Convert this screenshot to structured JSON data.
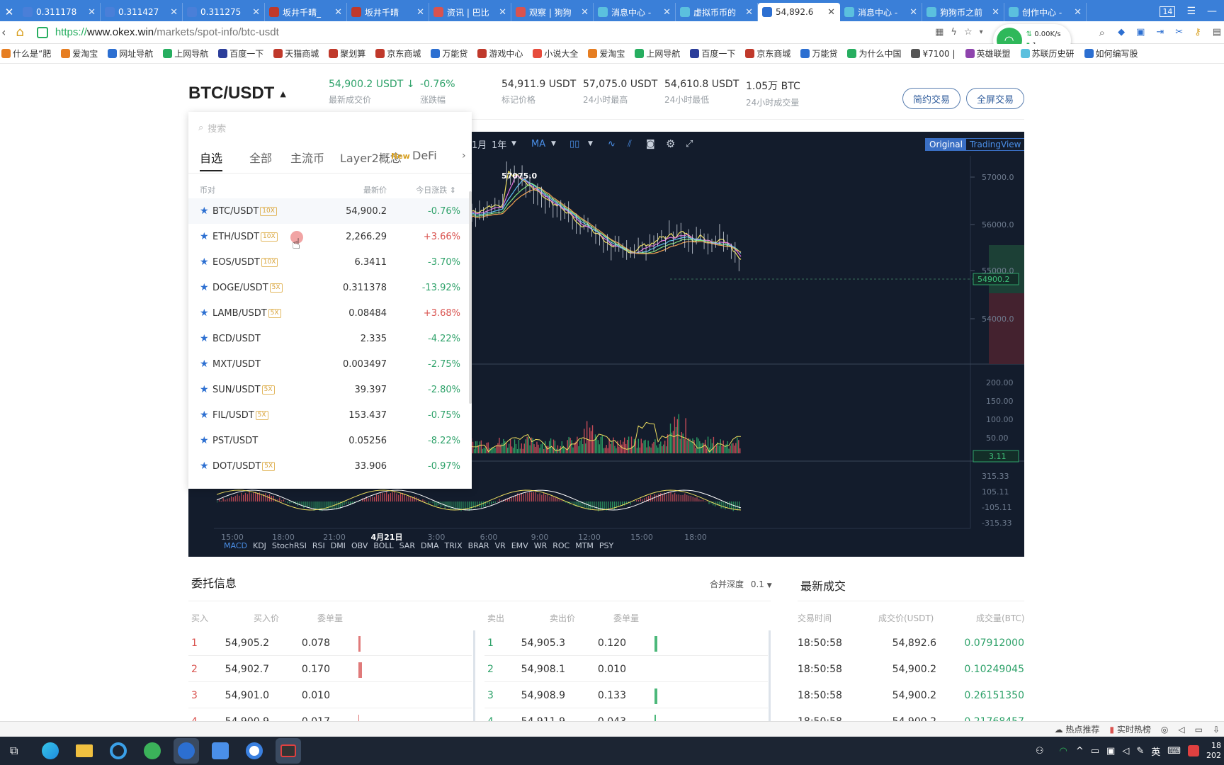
{
  "browser": {
    "tabs": [
      {
        "title": "0.311178",
        "fav": "#4a7fd8"
      },
      {
        "title": "0.311427",
        "fav": "#4a7fd8"
      },
      {
        "title": "0.311275",
        "fav": "#4a7fd8"
      },
      {
        "title": "坂井千晴_",
        "fav": "#c0392b"
      },
      {
        "title": "坂井千晴",
        "fav": "#c0392b"
      },
      {
        "title": "资讯 | 巴比",
        "fav": "#d9534f"
      },
      {
        "title": "观察 | 狗狗",
        "fav": "#d9534f"
      },
      {
        "title": "消息中心 -",
        "fav": "#5bc0de"
      },
      {
        "title": "虚拟币币的",
        "fav": "#5bc0de"
      },
      {
        "title": "54,892.6",
        "fav": "#2c6fd1"
      },
      {
        "title": "消息中心 -",
        "fav": "#5bc0de"
      },
      {
        "title": "狗狗币之前",
        "fav": "#5bc0de"
      },
      {
        "title": "创作中心 -",
        "fav": "#5bc0de"
      }
    ],
    "tab_count": "14",
    "url_scheme": "https://",
    "url_domain": "www.okex.win",
    "url_path": "/markets/spot-info/btc-usdt",
    "net_speed": "0.00K/s",
    "net_count": "1",
    "bookmarks": [
      {
        "label": "什么是“肥",
        "color": "#e67e22"
      },
      {
        "label": "爱淘宝",
        "color": "#e67e22"
      },
      {
        "label": "网址导航",
        "color": "#2c6fd1"
      },
      {
        "label": "上网导航",
        "color": "#27ae60"
      },
      {
        "label": "百度一下",
        "color": "#2c3e9a"
      },
      {
        "label": "天猫商城",
        "color": "#c0392b"
      },
      {
        "label": "聚划算",
        "color": "#c0392b"
      },
      {
        "label": "京东商城",
        "color": "#c0392b"
      },
      {
        "label": "万能贷",
        "color": "#2c6fd1"
      },
      {
        "label": "游戏中心",
        "color": "#c0392b"
      },
      {
        "label": "小说大全",
        "color": "#e74c3c"
      },
      {
        "label": "爱淘宝",
        "color": "#e67e22"
      },
      {
        "label": "上网导航",
        "color": "#27ae60"
      },
      {
        "label": "百度一下",
        "color": "#2c3e9a"
      },
      {
        "label": "京东商城",
        "color": "#c0392b"
      },
      {
        "label": "万能贷",
        "color": "#2c6fd1"
      },
      {
        "label": "为什么中国",
        "color": "#27ae60"
      },
      {
        "label": "¥7100 |",
        "color": "#555"
      },
      {
        "label": "英雄联盟",
        "color": "#8e44ad"
      },
      {
        "label": "苏联历史研",
        "color": "#5bc0de"
      },
      {
        "label": "如何编写股",
        "color": "#2c6fd1"
      }
    ]
  },
  "header": {
    "pair": "BTC/USDT",
    "last_price": "54,900.2 USDT",
    "last_price_label": "最新成交价",
    "change": "-0.76%",
    "change_label": "涨跌幅",
    "mark_price": "54,911.9 USDT",
    "mark_price_label": "标记价格",
    "high": "57,075.0 USDT",
    "high_label": "24小时最高",
    "low": "54,610.8 USDT",
    "low_label": "24小时最低",
    "volume": "1.05万 BTC",
    "volume_label": "24小时成交量",
    "btn_contract": "简约交易",
    "btn_fullscreen": "全屏交易"
  },
  "chart_toolbar": {
    "range1": "1月",
    "range2": "1年",
    "indicator": "MA",
    "view_original": "Original",
    "view_tv": "TradingView"
  },
  "chart": {
    "peak_label": "57075.0",
    "price_axis": [
      "57000.0",
      "56000.0",
      "55000.0",
      "54000.0"
    ],
    "current_price": "54900.2",
    "vol_axis": [
      "200.00",
      "150.00",
      "100.00",
      "50.00"
    ],
    "vol_current": "3.11",
    "macd_axis": [
      "315.33",
      "105.11",
      "-105.11",
      "-315.33"
    ],
    "time_axis": [
      "15:00",
      "18:00",
      "21:00",
      "4月21日",
      "3:00",
      "6:00",
      "9:00",
      "12:00",
      "15:00",
      "18:00"
    ],
    "indicators": [
      "MACD",
      "KDJ",
      "StochRSI",
      "RSI",
      "DMI",
      "OBV",
      "BOLL",
      "SAR",
      "DMA",
      "TRIX",
      "BRAR",
      "VR",
      "EMV",
      "WR",
      "ROC",
      "MTM",
      "PSY"
    ]
  },
  "dropdown": {
    "search_placeholder": "搜索",
    "tabs": [
      "自选",
      "全部",
      "主流币",
      "Layer2概念",
      "DeFi"
    ],
    "new_badge": "New",
    "col_pair": "币对",
    "col_price": "最新价",
    "col_change": "今日涨跌",
    "rows": [
      {
        "pair": "BTC/USDT",
        "lev": "10X",
        "price": "54,900.2",
        "change": "-0.76%",
        "up": false
      },
      {
        "pair": "ETH/USDT",
        "lev": "10X",
        "price": "2,266.29",
        "change": "+3.66%",
        "up": true
      },
      {
        "pair": "EOS/USDT",
        "lev": "10X",
        "price": "6.3411",
        "change": "-3.70%",
        "up": false
      },
      {
        "pair": "DOGE/USDT",
        "lev": "5X",
        "price": "0.311378",
        "change": "-13.92%",
        "up": false
      },
      {
        "pair": "LAMB/USDT",
        "lev": "5X",
        "price": "0.08484",
        "change": "+3.68%",
        "up": true
      },
      {
        "pair": "BCD/USDT",
        "lev": "",
        "price": "2.335",
        "change": "-4.22%",
        "up": false
      },
      {
        "pair": "MXT/USDT",
        "lev": "",
        "price": "0.003497",
        "change": "-2.75%",
        "up": false
      },
      {
        "pair": "SUN/USDT",
        "lev": "5X",
        "price": "39.397",
        "change": "-2.80%",
        "up": false
      },
      {
        "pair": "FIL/USDT",
        "lev": "5X",
        "price": "153.437",
        "change": "-0.75%",
        "up": false
      },
      {
        "pair": "PST/USDT",
        "lev": "",
        "price": "0.05256",
        "change": "-8.22%",
        "up": false
      },
      {
        "pair": "DOT/USDT",
        "lev": "5X",
        "price": "33.906",
        "change": "-0.97%",
        "up": false
      }
    ]
  },
  "orderbook": {
    "title": "委托信息",
    "depth_label": "合并深度",
    "depth_value": "0.1",
    "bid_cols": [
      "买入",
      "买入价",
      "委单量"
    ],
    "ask_cols": [
      "卖出",
      "卖出价",
      "委单量"
    ],
    "bids": [
      {
        "n": "1",
        "price": "54,905.2",
        "qty": "0.078",
        "bar": 0.1
      },
      {
        "n": "2",
        "price": "54,902.7",
        "qty": "0.170",
        "bar": 0.2
      },
      {
        "n": "3",
        "price": "54,901.0",
        "qty": "0.010",
        "bar": 0
      },
      {
        "n": "4",
        "price": "54,900.9",
        "qty": "0.017",
        "bar": 0.05
      }
    ],
    "asks": [
      {
        "n": "1",
        "price": "54,905.3",
        "qty": "0.120",
        "bar": 0.15
      },
      {
        "n": "2",
        "price": "54,908.1",
        "qty": "0.010",
        "bar": 0
      },
      {
        "n": "3",
        "price": "54,908.9",
        "qty": "0.133",
        "bar": 0.17
      },
      {
        "n": "4",
        "price": "54,911.9",
        "qty": "0.043",
        "bar": 0.06
      }
    ]
  },
  "trades": {
    "title": "最新成交",
    "cols": [
      "交易时间",
      "成交价(USDT)",
      "成交量(BTC)"
    ],
    "rows": [
      {
        "time": "18:50:58",
        "price": "54,892.6",
        "qty": "0.07912000"
      },
      {
        "time": "18:50:58",
        "price": "54,900.2",
        "qty": "0.10249045"
      },
      {
        "time": "18:50:58",
        "price": "54,900.2",
        "qty": "0.26151350"
      },
      {
        "time": "18:50:58",
        "price": "54,900.2",
        "qty": "0.21768457"
      }
    ]
  },
  "statusbar": {
    "hot": "热点推荐",
    "realtime": "实时热榜"
  },
  "taskbar": {
    "ime": "英",
    "clock_top": "18",
    "clock_bottom": "202"
  },
  "colors": {
    "accent": "#2c6fd1",
    "up": "#d9534f",
    "down": "#2fa26a",
    "chart_bg": "#131c2c"
  }
}
